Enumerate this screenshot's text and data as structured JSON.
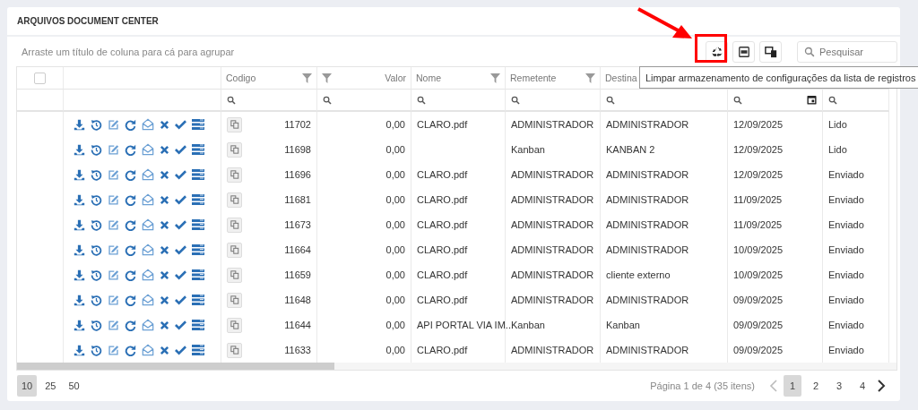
{
  "title": "ARQUIVOS DOCUMENT CENTER",
  "group_hint": "Arraste um título de coluna para cá para agrupar",
  "search": {
    "placeholder": "Pesquisar"
  },
  "tooltip": "Limpar armazenamento de configurações da lista de registros",
  "select_all": {
    "checked": false
  },
  "columns": [
    {
      "label": "Codigo",
      "kind": "text",
      "filter": true
    },
    {
      "label": "Valor",
      "kind": "number",
      "filter": true
    },
    {
      "label": "Nome",
      "kind": "text",
      "filter": true
    },
    {
      "label": "Remetente",
      "kind": "text",
      "filter": true
    },
    {
      "label": "Destina",
      "kind": "text"
    }
  ],
  "rows": [
    {
      "codigo": "11702",
      "valor": "0,00",
      "nome": "CLARO.pdf",
      "remetente": "ADMINISTRADOR",
      "destinatario": "ADMINISTRADOR",
      "data": "12/09/2025",
      "status": "Lido"
    },
    {
      "codigo": "11698",
      "valor": "0,00",
      "remetente": "Kanban",
      "destinatario": "KANBAN 2",
      "data": "12/09/2025",
      "status": "Lido"
    },
    {
      "codigo": "11696",
      "valor": "0,00",
      "nome": "CLARO.pdf",
      "remetente": "ADMINISTRADOR",
      "destinatario": "ADMINISTRADOR",
      "data": "12/09/2025",
      "status": "Enviado"
    },
    {
      "codigo": "11681",
      "valor": "0,00",
      "nome": "CLARO.pdf",
      "remetente": "ADMINISTRADOR",
      "destinatario": "ADMINISTRADOR",
      "data": "11/09/2025",
      "status": "Enviado"
    },
    {
      "codigo": "11673",
      "valor": "0,00",
      "nome": "CLARO.pdf",
      "remetente": "ADMINISTRADOR",
      "destinatario": "ADMINISTRADOR",
      "data": "11/09/2025",
      "status": "Enviado"
    },
    {
      "codigo": "11664",
      "valor": "0,00",
      "nome": "CLARO.pdf",
      "remetente": "ADMINISTRADOR",
      "destinatario": "ADMINISTRADOR",
      "data": "10/09/2025",
      "status": "Enviado"
    },
    {
      "codigo": "11659",
      "valor": "0,00",
      "nome": "CLARO.pdf",
      "remetente": "ADMINISTRADOR",
      "destinatario": "cliente externo",
      "data": "10/09/2025",
      "status": "Enviado"
    },
    {
      "codigo": "11648",
      "valor": "0,00",
      "nome": "CLARO.pdf",
      "remetente": "ADMINISTRADOR",
      "destinatario": "ADMINISTRADOR",
      "data": "09/09/2025",
      "status": "Enviado"
    },
    {
      "codigo": "11644",
      "valor": "0,00",
      "nome": "API PORTAL VIA IM...",
      "remetente": "Kanban",
      "destinatario": "Kanban",
      "data": "09/09/2025",
      "status": "Enviado"
    },
    {
      "codigo": "11633",
      "valor": "0,00",
      "nome": "CLARO.pdf",
      "remetente": "ADMINISTRADOR",
      "destinatario": "ADMINISTRADOR",
      "data": "09/09/2025",
      "status": "Enviado"
    }
  ],
  "page_sizes": [
    {
      "label": "10",
      "selected": true
    },
    {
      "label": "25",
      "selected": false
    },
    {
      "label": "50",
      "selected": false
    }
  ],
  "pager_info": "Página 1 de 4 (35 itens)",
  "pages": [
    {
      "label": "1",
      "selected": true
    },
    {
      "label": "2",
      "selected": false
    },
    {
      "label": "3",
      "selected": false
    },
    {
      "label": "4",
      "selected": false
    }
  ]
}
